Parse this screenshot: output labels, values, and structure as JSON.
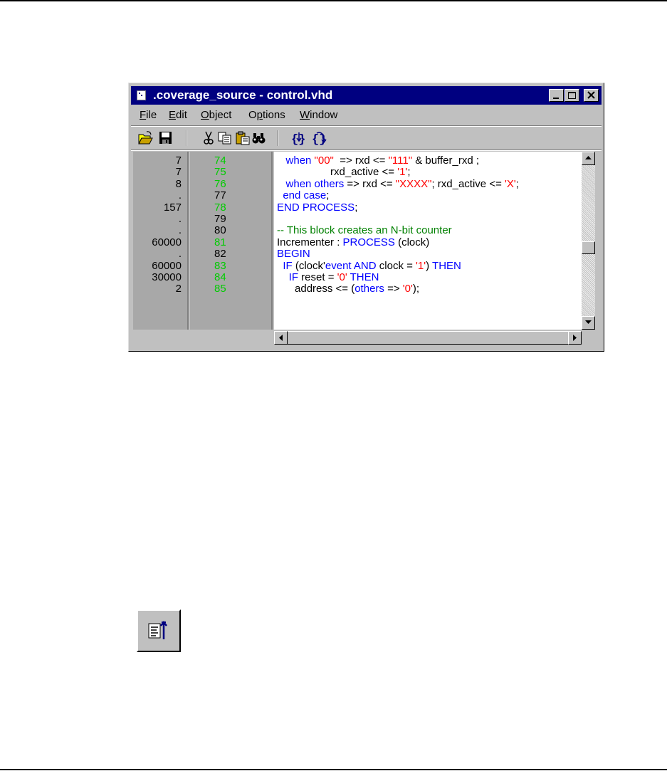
{
  "window": {
    "title": ".coverage_source - control.vhd"
  },
  "menu": [
    {
      "pre": "",
      "ul": "F",
      "post": "ile"
    },
    {
      "pre": "",
      "ul": "E",
      "post": "dit"
    },
    {
      "pre": "",
      "ul": "O",
      "post": "bject"
    },
    {
      "pre": "O",
      "ul": "p",
      "post": "tions"
    },
    {
      "pre": "",
      "ul": "W",
      "post": "indow"
    }
  ],
  "toolbar_icons": [
    "open-folder-icon",
    "save-icon",
    "cut-icon",
    "copy-icon",
    "paste-icon",
    "find-icon",
    "step-into-icon",
    "step-over-icon"
  ],
  "colors": {
    "keyword": "#0000ff",
    "string": "#ff0000",
    "comment": "#008000",
    "covered_line_number": "#00cc00",
    "title_bar": "#000080",
    "gutter": "#a8a8a8"
  },
  "coverage_counts": [
    "7",
    "7",
    "8",
    ".",
    "157",
    ".",
    ".",
    "60000",
    ".",
    "60000",
    "30000",
    "2"
  ],
  "line_numbers": [
    {
      "num": "74",
      "covered": true
    },
    {
      "num": "75",
      "covered": true
    },
    {
      "num": "76",
      "covered": true
    },
    {
      "num": "77",
      "covered": false
    },
    {
      "num": "78",
      "covered": true
    },
    {
      "num": "79",
      "covered": false
    },
    {
      "num": "80",
      "covered": false
    },
    {
      "num": "81",
      "covered": true
    },
    {
      "num": "82",
      "covered": false
    },
    {
      "num": "83",
      "covered": true
    },
    {
      "num": "84",
      "covered": true
    },
    {
      "num": "85",
      "covered": true
    }
  ],
  "code_lines": [
    [
      {
        "t": "   "
      },
      {
        "t": "when ",
        "c": "kw"
      },
      {
        "t": "\"00\"",
        "c": "str"
      },
      {
        "t": "  => rxd <= "
      },
      {
        "t": "\"111\"",
        "c": "str"
      },
      {
        "t": " & buffer_rxd ;"
      }
    ],
    [
      {
        "t": "                  rxd_active <= "
      },
      {
        "t": "'1'",
        "c": "str"
      },
      {
        "t": ";"
      }
    ],
    [
      {
        "t": "   "
      },
      {
        "t": "when others",
        "c": "kw"
      },
      {
        "t": " => rxd <= "
      },
      {
        "t": "\"XXXX\"",
        "c": "str"
      },
      {
        "t": "; rxd_active <= "
      },
      {
        "t": "'X'",
        "c": "str"
      },
      {
        "t": ";"
      }
    ],
    [
      {
        "t": "  "
      },
      {
        "t": "end case",
        "c": "kw"
      },
      {
        "t": ";"
      }
    ],
    [
      {
        "t": "END PROCESS",
        "c": "kw"
      },
      {
        "t": ";"
      }
    ],
    [
      {
        "t": ""
      }
    ],
    [
      {
        "t": "-- This block creates an N-bit counter",
        "c": "cmt"
      }
    ],
    [
      {
        "t": "Incrementer : "
      },
      {
        "t": "PROCESS",
        "c": "kw"
      },
      {
        "t": " (clock)"
      }
    ],
    [
      {
        "t": "BEGIN",
        "c": "kw"
      }
    ],
    [
      {
        "t": "  "
      },
      {
        "t": "IF",
        "c": "kw"
      },
      {
        "t": " (clock'"
      },
      {
        "t": "event AND",
        "c": "kw"
      },
      {
        "t": " clock = "
      },
      {
        "t": "'1'",
        "c": "str"
      },
      {
        "t": ") "
      },
      {
        "t": "THEN",
        "c": "kw"
      }
    ],
    [
      {
        "t": "    "
      },
      {
        "t": "IF",
        "c": "kw"
      },
      {
        "t": " reset = "
      },
      {
        "t": "'0'",
        "c": "str"
      },
      {
        "t": " "
      },
      {
        "t": "THEN",
        "c": "kw"
      }
    ],
    [
      {
        "t": "      address <= ("
      },
      {
        "t": "others",
        "c": "kw"
      },
      {
        "t": " => "
      },
      {
        "t": "'0'",
        "c": "str"
      },
      {
        "t": ");"
      }
    ]
  ],
  "vertical_scroll_fraction": 0.55,
  "standalone_icon": "show-line-coverage-icon"
}
